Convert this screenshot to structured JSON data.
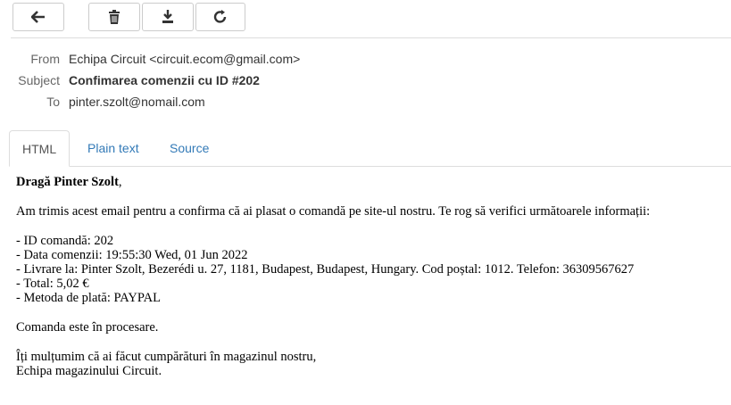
{
  "toolbar": {
    "buttons": [
      {
        "icon": "arrow-left-icon"
      },
      {
        "icon": "trash-icon"
      },
      {
        "icon": "download-icon"
      },
      {
        "icon": "forward-icon"
      }
    ]
  },
  "headers": {
    "from_label": "From",
    "from_value": "Echipa Circuit <circuit.ecom@gmail.com>",
    "subject_label": "Subject",
    "subject_value": "Confimarea comenzii cu ID #202",
    "to_label": "To",
    "to_value": "pinter.szolt@nomail.com"
  },
  "tabs": [
    {
      "label": "HTML",
      "active": true
    },
    {
      "label": "Plain text",
      "active": false
    },
    {
      "label": "Source",
      "active": false
    }
  ],
  "message": {
    "greeting_name": "Dragă Pinter Szolt",
    "greeting_comma": ",",
    "intro": "Am trimis acest email pentru a confirma că ai plasat o comandă pe site-ul nostru. Te rog să verifici următoarele informații:",
    "details": [
      "- ID comandă: 202",
      "- Data comenzii: 19:55:30 Wed, 01 Jun 2022",
      "- Livrare la: Pinter Szolt, Bezerédi u. 27, 1181, Budapest, Budapest, Hungary. Cod poștal: 1012. Telefon: 36309567627",
      "- Total: 5,02 €",
      "- Metoda de plată: PAYPAL"
    ],
    "status": "Comanda este în procesare.",
    "closing_1": "Îți mulțumim că ai făcut cumpărături în magazinul nostru,",
    "closing_2": "Echipa magazinului Circuit."
  },
  "colors": {
    "link": "#337ab7",
    "border": "#dddddd",
    "label": "#666666"
  }
}
